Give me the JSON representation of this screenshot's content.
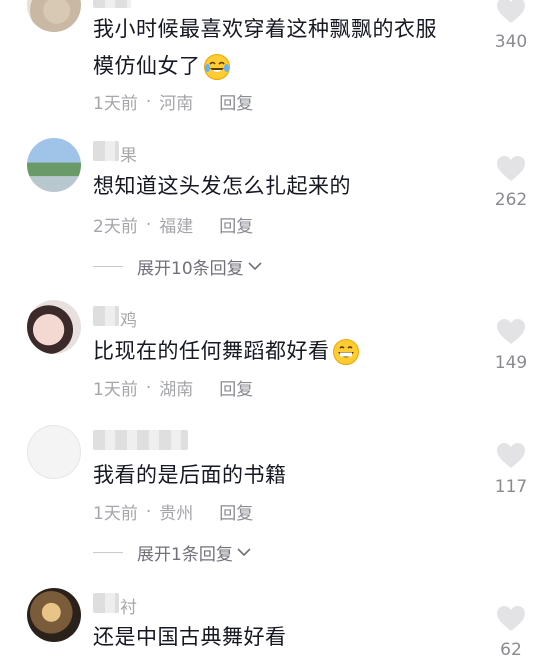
{
  "comments": [
    {
      "text_lines": [
        "我小时候最喜欢穿着这种飘飘的衣服",
        "模仿仙女了"
      ],
      "emoji": "laughing-tears-emoji",
      "time": "1天前",
      "location": "河南",
      "reply": "回复",
      "likes": "340"
    },
    {
      "name_tail": "果",
      "text": "想知道这头发怎么扎起来的",
      "time": "2天前",
      "location": "福建",
      "reply": "回复",
      "likes": "262",
      "expand": "展开10条回复"
    },
    {
      "name_tail": "鸡",
      "text": "比现在的任何舞蹈都好看",
      "emoji": "grinning-emoji",
      "time": "1天前",
      "location": "湖南",
      "reply": "回复",
      "likes": "149"
    },
    {
      "text": "我看的是后面的书籍",
      "time": "1天前",
      "location": "贵州",
      "reply": "回复",
      "likes": "117",
      "expand": "展开1条回复"
    },
    {
      "name_tail": "衬",
      "text": "还是中国古典舞好看",
      "likes": "62"
    }
  ],
  "colors": {
    "text": "#161823",
    "meta": "#a5a6aa",
    "heart": "#e3e3e5"
  }
}
